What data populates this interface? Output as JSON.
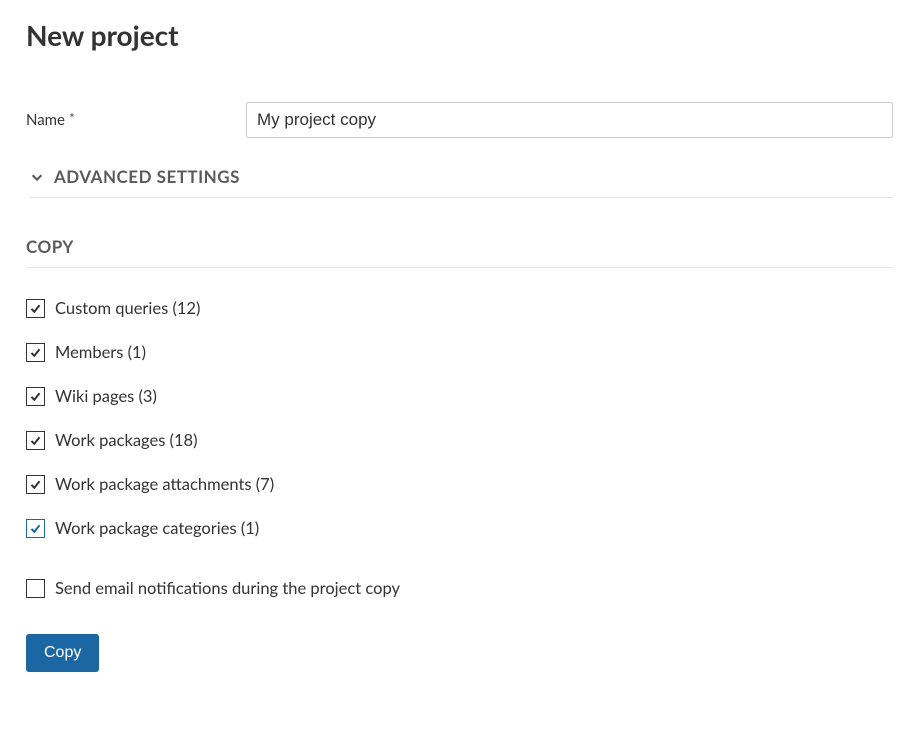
{
  "page_title": "New project",
  "name_field": {
    "label": "Name",
    "required_mark": "*",
    "value": "My project copy"
  },
  "advanced_settings_label": "Advanced settings",
  "copy_section_label": "Copy",
  "copy_options": [
    {
      "label": "Custom queries (12)",
      "checked": true,
      "focused": false
    },
    {
      "label": "Members (1)",
      "checked": true,
      "focused": false
    },
    {
      "label": "Wiki pages (3)",
      "checked": true,
      "focused": false
    },
    {
      "label": "Work packages (18)",
      "checked": true,
      "focused": false
    },
    {
      "label": "Work package attachments (7)",
      "checked": true,
      "focused": false
    },
    {
      "label": "Work package categories (1)",
      "checked": true,
      "focused": true
    }
  ],
  "notify_option": {
    "label": "Send email notifications during the project copy",
    "checked": false
  },
  "submit_button_label": "Copy"
}
